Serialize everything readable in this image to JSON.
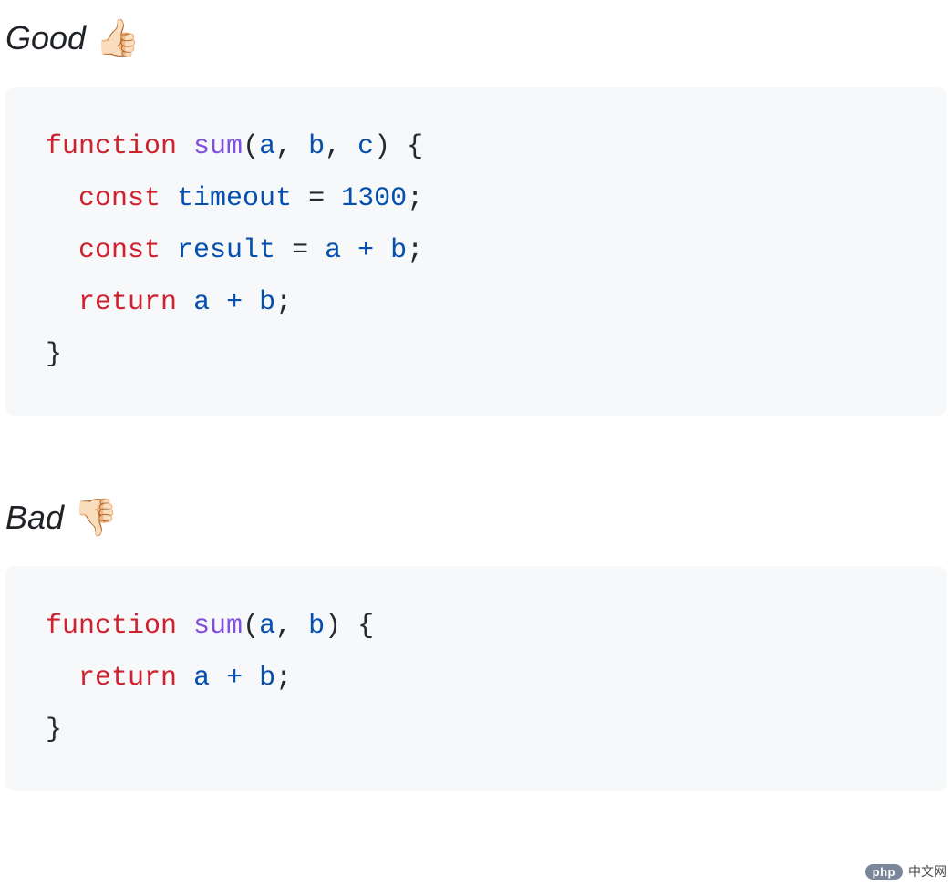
{
  "good": {
    "label": "Good",
    "emoji": "👍🏻",
    "code": {
      "kw_function": "function",
      "fn_name": "sum",
      "params_open": "(",
      "p1": "a",
      "comma1": ", ",
      "p2": "b",
      "comma2": ", ",
      "p3": "c",
      "params_close": ") {",
      "line2_kw": "const",
      "line2_var": "timeout",
      "line2_eq": " = ",
      "line2_num": "1300",
      "line2_semi": ";",
      "line3_kw": "const",
      "line3_var": "result",
      "line3_eq": " = ",
      "line3_a": "a",
      "line3_plus": " + ",
      "line3_b": "b",
      "line3_semi": ";",
      "line4_kw": "return",
      "line4_a": "a",
      "line4_plus": " + ",
      "line4_b": "b",
      "line4_semi": ";",
      "close_brace": "}"
    }
  },
  "bad": {
    "label": "Bad",
    "emoji": "👎🏻",
    "code": {
      "kw_function": "function",
      "fn_name": "sum",
      "params_open": "(",
      "p1": "a",
      "comma1": ", ",
      "p2": "b",
      "params_close": ") {",
      "line2_kw": "return",
      "line2_a": "a",
      "line2_plus": " + ",
      "line2_b": "b",
      "line2_semi": ";",
      "close_brace": "}"
    }
  },
  "watermark": {
    "pill": "php",
    "text": "中文网"
  }
}
